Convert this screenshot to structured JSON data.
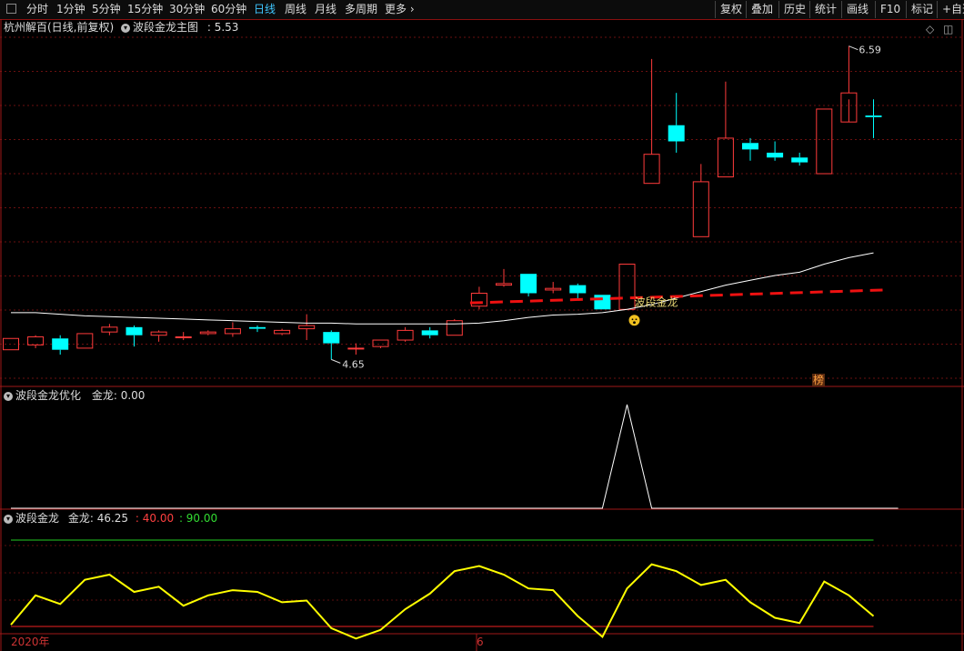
{
  "toolbar": {
    "periods": [
      "分时",
      "1分钟",
      "5分钟",
      "15分钟",
      "30分钟",
      "60分钟",
      "日线",
      "周线",
      "月线",
      "多周期",
      "更多"
    ],
    "active": "日线",
    "right_buttons": [
      "复权",
      "叠加",
      "历史",
      "统计",
      "画线",
      "F10",
      "标记",
      "+自选"
    ]
  },
  "main_panel": {
    "stock": "杭州解百(日线,前复权)",
    "indicator": "波段金龙主图",
    "value": ": 5.53",
    "signal_label": "波段金龙",
    "badge": "榜"
  },
  "panel2": {
    "title": "波段金龙优化",
    "series_label": "金龙: 0.00"
  },
  "panel3": {
    "title": "波段金龙",
    "series_label": "金龙: 46.25",
    "level_low": ": 40.00",
    "level_high": ": 90.00"
  },
  "x_axis": {
    "year_label": "2020年",
    "month_label": "6"
  },
  "colors": {
    "up": "#ff3b3b",
    "down": "#00ffff",
    "ma": "#ffffff",
    "support": "#ee1111",
    "osc": "#ffff00",
    "high_line": "#22cc22",
    "low_line": "#ee2222"
  },
  "chart_data": [
    {
      "type": "candlestick",
      "price_range": [
        4.5,
        6.65
      ],
      "annotations": {
        "high": "6.59",
        "low": "4.65"
      },
      "candles": [
        {
          "o": 4.71,
          "h": 4.78,
          "l": 4.71,
          "c": 4.78
        },
        {
          "o": 4.74,
          "h": 4.8,
          "l": 4.72,
          "c": 4.79
        },
        {
          "o": 4.78,
          "h": 4.8,
          "l": 4.68,
          "c": 4.71
        },
        {
          "o": 4.72,
          "h": 4.81,
          "l": 4.72,
          "c": 4.81
        },
        {
          "o": 4.82,
          "h": 4.87,
          "l": 4.8,
          "c": 4.85
        },
        {
          "o": 4.85,
          "h": 4.86,
          "l": 4.73,
          "c": 4.8
        },
        {
          "o": 4.8,
          "h": 4.83,
          "l": 4.76,
          "c": 4.82
        },
        {
          "o": 4.79,
          "h": 4.82,
          "l": 4.77,
          "c": 4.79
        },
        {
          "o": 4.81,
          "h": 4.83,
          "l": 4.8,
          "c": 4.82
        },
        {
          "o": 4.81,
          "h": 4.88,
          "l": 4.79,
          "c": 4.84
        },
        {
          "o": 4.85,
          "h": 4.86,
          "l": 4.82,
          "c": 4.84
        },
        {
          "o": 4.81,
          "h": 4.84,
          "l": 4.8,
          "c": 4.83
        },
        {
          "o": 4.84,
          "h": 4.93,
          "l": 4.77,
          "c": 4.86
        },
        {
          "o": 4.82,
          "h": 4.83,
          "l": 4.65,
          "c": 4.75
        },
        {
          "o": 4.72,
          "h": 4.75,
          "l": 4.68,
          "c": 4.72
        },
        {
          "o": 4.73,
          "h": 4.77,
          "l": 4.72,
          "c": 4.77
        },
        {
          "o": 4.77,
          "h": 4.85,
          "l": 4.76,
          "c": 4.83
        },
        {
          "o": 4.83,
          "h": 4.85,
          "l": 4.78,
          "c": 4.8
        },
        {
          "o": 4.8,
          "h": 4.9,
          "l": 4.8,
          "c": 4.89
        },
        {
          "o": 4.98,
          "h": 5.1,
          "l": 4.96,
          "c": 5.06
        },
        {
          "o": 5.11,
          "h": 5.21,
          "l": 5.1,
          "c": 5.12
        },
        {
          "o": 5.18,
          "h": 5.18,
          "l": 5.04,
          "c": 5.06
        },
        {
          "o": 5.08,
          "h": 5.13,
          "l": 5.06,
          "c": 5.09
        },
        {
          "o": 5.11,
          "h": 5.12,
          "l": 5.02,
          "c": 5.06
        },
        {
          "o": 5.05,
          "h": 5.05,
          "l": 4.96,
          "c": 4.96
        },
        {
          "o": 4.96,
          "h": 5.24,
          "l": 4.96,
          "c": 5.24
        },
        {
          "o": 5.74,
          "h": 6.51,
          "l": 5.74,
          "c": 5.92
        },
        {
          "o": 6.1,
          "h": 6.3,
          "l": 5.93,
          "c": 6.0
        },
        {
          "o": 5.41,
          "h": 5.86,
          "l": 5.41,
          "c": 5.75
        },
        {
          "o": 5.78,
          "h": 6.37,
          "l": 5.78,
          "c": 6.02
        },
        {
          "o": 5.99,
          "h": 6.02,
          "l": 5.88,
          "c": 5.95
        },
        {
          "o": 5.93,
          "h": 6.0,
          "l": 5.88,
          "c": 5.9
        },
        {
          "o": 5.9,
          "h": 5.93,
          "l": 5.85,
          "c": 5.87
        },
        {
          "o": 5.8,
          "h": 6.2,
          "l": 5.8,
          "c": 6.2
        },
        {
          "o": 6.12,
          "h": 6.59,
          "l": 6.26,
          "c": 6.3
        },
        {
          "o": 6.16,
          "h": 6.26,
          "l": 6.02,
          "c": 6.15
        }
      ],
      "ma_line": [
        4.94,
        4.94,
        4.93,
        4.92,
        4.915,
        4.91,
        4.905,
        4.9,
        4.895,
        4.89,
        4.885,
        4.88,
        4.875,
        4.875,
        4.87,
        4.87,
        4.87,
        4.87,
        4.87,
        4.875,
        4.89,
        4.91,
        4.925,
        4.93,
        4.94,
        4.96,
        4.99,
        5.03,
        5.07,
        5.11,
        5.14,
        5.17,
        5.19,
        5.24,
        5.28,
        5.31
      ],
      "support_line": [
        {
          "i": 19,
          "v": 5.0
        },
        {
          "i": 35,
          "v": 5.08
        }
      ],
      "signal_index": 25
    },
    {
      "type": "line",
      "range": [
        0,
        1
      ],
      "values": [
        0,
        0,
        0,
        0,
        0,
        0,
        0,
        0,
        0,
        0,
        0,
        0,
        0,
        0,
        0,
        0,
        0,
        0,
        0,
        0,
        0,
        0,
        0,
        0,
        0,
        1,
        0,
        0,
        0,
        0,
        0,
        0,
        0,
        0,
        0,
        0,
        0
      ]
    },
    {
      "type": "line",
      "range": [
        30,
        100
      ],
      "levels": [
        40,
        90
      ],
      "values": [
        41,
        58,
        53,
        67,
        70,
        60,
        63,
        52,
        58,
        61,
        60,
        54,
        55,
        39,
        33,
        38,
        50,
        59,
        72,
        75,
        70,
        62,
        61,
        46,
        34,
        62,
        76,
        72,
        64,
        67,
        54,
        45,
        42,
        66,
        58,
        46
      ]
    }
  ]
}
